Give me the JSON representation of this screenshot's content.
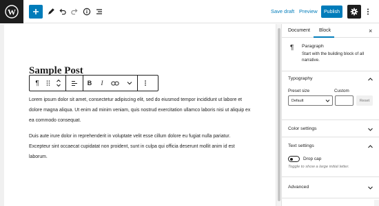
{
  "topbar": {
    "save_draft": "Save draft",
    "preview": "Preview",
    "publish": "Publish",
    "icons": [
      "wordpress-logo",
      "plus-icon",
      "pencil-icon",
      "undo-icon",
      "redo-icon",
      "info-icon",
      "list-view-icon",
      "gear-icon",
      "more-vertical-icon"
    ]
  },
  "editor": {
    "post_title": "Sample Post",
    "block_toolbar_icons": [
      "paragraph-icon",
      "drag-handle-icon",
      "move-up-down-icon",
      "align-left-icon",
      "bold-icon",
      "italic-icon",
      "link-icon",
      "chevron-down-icon",
      "more-vertical-icon"
    ],
    "paragraphs": [
      "Lorem ipsum dolor sit amet, consectetur adipiscing elit, sed do eiusmod tempor incididunt ut labore et dolore magna aliqua. Ut enim ad minim veniam, quis nostrud exercitation ullamco laboris nisi ut aliquip ex ea commodo consequat.",
      "Duis aute irure dolor in reprehenderit in voluptate velit esse cillum dolore eu fugiat nulla pariatur. Excepteur sint occaecat cupidatat non proident, sunt in culpa qui officia deserunt mollit anim id est laborum."
    ]
  },
  "sidebar": {
    "tabs": {
      "document": "Document",
      "block": "Block",
      "active": "Block"
    },
    "block_card": {
      "title": "Paragraph",
      "description": "Start with the building block of all narrative."
    },
    "typography": {
      "title": "Typography",
      "preset_label": "Preset size",
      "custom_label": "Custom",
      "preset_value": "Default",
      "reset_label": "Reset"
    },
    "color_settings": {
      "title": "Color settings"
    },
    "text_settings": {
      "title": "Text settings",
      "drop_cap_label": "Drop cap",
      "drop_cap_help": "Toggle to show a large initial letter.",
      "drop_cap_on": false
    },
    "advanced": {
      "title": "Advanced"
    }
  },
  "colors": {
    "accent": "#007cba",
    "dark": "#1e1e1e",
    "border": "#e0e0e0",
    "muted": "#757575"
  }
}
